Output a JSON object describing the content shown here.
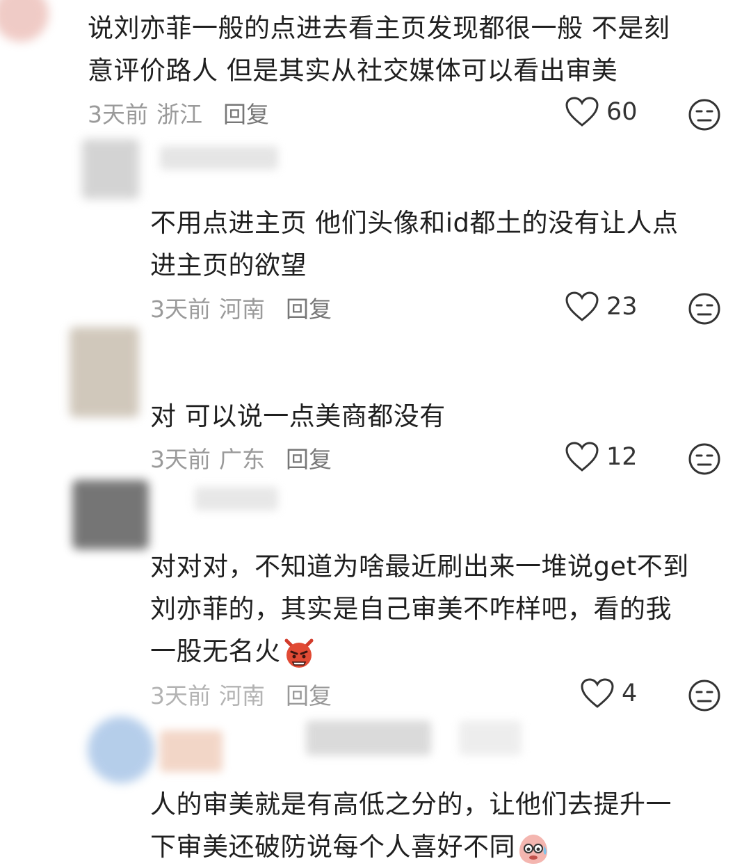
{
  "comments": [
    {
      "text_lines": [
        "说刘亦菲一般的点进去看主页发现都很一般 不是刻",
        "意评价路人 但是其实从社交媒体可以看出审美"
      ],
      "time": "3天前",
      "location": "浙江",
      "reply": "回复",
      "likes": "60"
    },
    {
      "text_lines": [
        "不用点进主页 他们头像和id都土的没有让人点",
        "进主页的欲望"
      ],
      "time": "3天前",
      "location": "河南",
      "reply": "回复",
      "likes": "23"
    },
    {
      "text_lines": [
        "对 可以说一点美商都没有"
      ],
      "time": "3天前",
      "location": "广东",
      "reply": "回复",
      "likes": "12"
    },
    {
      "text_lines": [
        "对对对，不知道为啥最近刷出来一堆说get不到",
        "刘亦菲的，其实是自己审美不咋样吧，看的我",
        "一股无名火"
      ],
      "emoji": "angry-devil-emoji",
      "time": "3天前",
      "location": "河南",
      "reply": "回复",
      "likes": "4"
    },
    {
      "text_lines": [
        "人的审美就是有高低之分的，让他们去提升一",
        "下审美还破防说每个人喜好不同"
      ],
      "emoji": "sweating-face-emoji"
    }
  ],
  "icons": {
    "like": "heart-outline-icon",
    "dislike": "neutral-face-icon"
  },
  "colors": {
    "text": "#1f1f1f",
    "meta": "#9a9a9a"
  }
}
